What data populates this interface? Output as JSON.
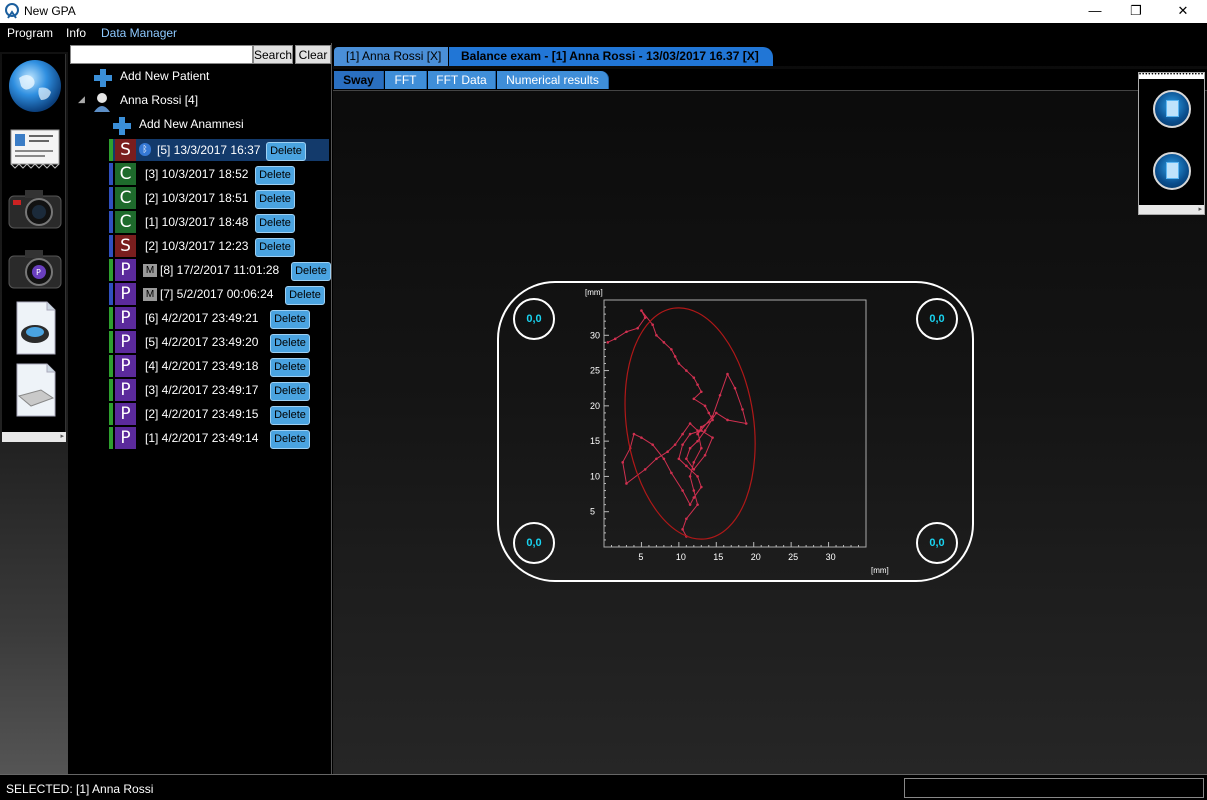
{
  "window": {
    "title": "New GPA",
    "minimize_glyph": "—",
    "maximize_glyph": "❐",
    "close_glyph": "✕"
  },
  "menu": {
    "program": "Program",
    "info": "Info",
    "data_manager": "Data Manager"
  },
  "toolbar": {
    "tools": [
      "globe-icon",
      "id-card-icon",
      "camera-icon",
      "camera-p-icon",
      "document-foot-icon",
      "document-platform-icon"
    ],
    "collapse_glyph": "▸"
  },
  "tree": {
    "search_placeholder": "",
    "search_label": "Search",
    "clear_label": "Clear",
    "add_patient_label": "Add New Patient",
    "patient_label": "Anna Rossi [4]",
    "add_anamnesis_label": "Add New Anamnesi",
    "delete_label": "Delete",
    "exams": [
      {
        "type": "S",
        "type_color": "#7a1e1e",
        "bar_color": "#2ea02e",
        "label": "[5] 13/3/2017 16:37",
        "bluetooth": true,
        "manual": false,
        "selected": true
      },
      {
        "type": "C",
        "type_color": "#1e6b2c",
        "bar_color": "#3050c0",
        "label": "[3] 10/3/2017 18:52",
        "bluetooth": false,
        "manual": false,
        "selected": false
      },
      {
        "type": "C",
        "type_color": "#1e6b2c",
        "bar_color": "#3050c0",
        "label": "[2] 10/3/2017 18:51",
        "bluetooth": false,
        "manual": false,
        "selected": false
      },
      {
        "type": "C",
        "type_color": "#1e6b2c",
        "bar_color": "#3050c0",
        "label": "[1] 10/3/2017 18:48",
        "bluetooth": false,
        "manual": false,
        "selected": false
      },
      {
        "type": "S",
        "type_color": "#7a1e1e",
        "bar_color": "#3050c0",
        "label": "[2] 10/3/2017 12:23",
        "bluetooth": false,
        "manual": false,
        "selected": false
      },
      {
        "type": "P",
        "type_color": "#5b2a9c",
        "bar_color": "#2ea02e",
        "label": "[8] 17/2/2017 11:01:28",
        "bluetooth": false,
        "manual": true,
        "selected": false
      },
      {
        "type": "P",
        "type_color": "#5b2a9c",
        "bar_color": "#3050c0",
        "label": "[7] 5/2/2017 00:06:24",
        "bluetooth": false,
        "manual": true,
        "selected": false
      },
      {
        "type": "P",
        "type_color": "#5b2a9c",
        "bar_color": "#2ea02e",
        "label": "[6] 4/2/2017 23:49:21",
        "bluetooth": false,
        "manual": false,
        "selected": false
      },
      {
        "type": "P",
        "type_color": "#5b2a9c",
        "bar_color": "#2ea02e",
        "label": "[5] 4/2/2017 23:49:20",
        "bluetooth": false,
        "manual": false,
        "selected": false
      },
      {
        "type": "P",
        "type_color": "#5b2a9c",
        "bar_color": "#2ea02e",
        "label": "[4] 4/2/2017 23:49:18",
        "bluetooth": false,
        "manual": false,
        "selected": false
      },
      {
        "type": "P",
        "type_color": "#5b2a9c",
        "bar_color": "#2ea02e",
        "label": "[3] 4/2/2017 23:49:17",
        "bluetooth": false,
        "manual": false,
        "selected": false
      },
      {
        "type": "P",
        "type_color": "#5b2a9c",
        "bar_color": "#2ea02e",
        "label": "[2] 4/2/2017 23:49:15",
        "bluetooth": false,
        "manual": false,
        "selected": false
      },
      {
        "type": "P",
        "type_color": "#5b2a9c",
        "bar_color": "#2ea02e",
        "label": "[1] 4/2/2017 23:49:14",
        "bluetooth": false,
        "manual": false,
        "selected": false
      }
    ],
    "manual_badge": "M",
    "bluetooth_glyph": "ᛒ"
  },
  "tabs": {
    "doc_tab_1": "[1] Anna Rossi [X]",
    "doc_tab_2": "Balance exam - [1] Anna Rossi - 13/03/2017 16.37 [X]",
    "sway": "Sway",
    "fft": "FFT",
    "fft_data": "FFT Data",
    "numerical": "Numerical results"
  },
  "side_panel": {
    "buttons": [
      "pdf-export-icon",
      "xls-export-icon"
    ],
    "collapse_glyph": "▸"
  },
  "plot": {
    "corner_values": [
      "0,0",
      "0,0",
      "0,0",
      "0,0"
    ],
    "x_unit": "[mm]",
    "y_unit": "[mm]",
    "x_ticks": [
      "5",
      "10",
      "15",
      "20",
      "25",
      "30"
    ],
    "y_ticks": [
      "5",
      "10",
      "15",
      "20",
      "25",
      "30"
    ],
    "trace_color": "#d03050",
    "ellipse_color": "#b01818"
  },
  "chart_data": {
    "type": "scatter",
    "xlabel": "[mm]",
    "ylabel": "[mm]",
    "xlim": [
      0,
      35
    ],
    "ylim": [
      0,
      35
    ],
    "grid": false,
    "series": [
      {
        "x": [
          0.5,
          1.5,
          3.0,
          4.5,
          5.5,
          5.0,
          6.5,
          7.0,
          8.0,
          9.0,
          9.5,
          10.0,
          11.0,
          12.0,
          12.5,
          13.0,
          12.0,
          13.5,
          14.0,
          14.5,
          13.0,
          12.5,
          14.5,
          15.5,
          16.5,
          17.5,
          18.5,
          19.0,
          16.5,
          15.0,
          13.5,
          12.5,
          11.5,
          11.0,
          12.0,
          13.5,
          14.5,
          13.0,
          11.5,
          10.5,
          10.0,
          11.0,
          12.5,
          13.0,
          12.0,
          11.5,
          10.5,
          9.0,
          8.0,
          6.5,
          5.0,
          4.0,
          3.5,
          2.5,
          3.0,
          5.5,
          7.0,
          8.5,
          9.5,
          10.5,
          11.5,
          12.5,
          13.0,
          12.0,
          11.5,
          12.0,
          12.5,
          11.0,
          10.5,
          11.0
        ],
        "y": [
          29.0,
          29.5,
          30.5,
          31.0,
          32.5,
          33.5,
          31.5,
          30.0,
          29.0,
          28.0,
          27.0,
          26.0,
          25.0,
          24.0,
          23.0,
          22.0,
          21.0,
          20.0,
          19.0,
          18.0,
          17.0,
          16.0,
          18.5,
          21.5,
          24.5,
          22.5,
          19.5,
          17.5,
          18.0,
          19.0,
          16.5,
          15.0,
          14.0,
          12.5,
          11.0,
          13.0,
          15.5,
          16.5,
          16.0,
          14.5,
          12.5,
          11.5,
          10.0,
          8.5,
          7.0,
          6.0,
          8.0,
          10.5,
          12.5,
          14.5,
          15.5,
          16.0,
          14.0,
          12.0,
          9.0,
          11.0,
          12.5,
          13.5,
          14.5,
          16.0,
          17.5,
          16.5,
          14.0,
          12.0,
          10.0,
          8.0,
          6.0,
          4.0,
          2.5,
          1.5
        ]
      }
    ],
    "ellipse": {
      "cx": 11.5,
      "cy": 17.5,
      "rx": 8.5,
      "ry": 16.5
    }
  },
  "status": {
    "text": "SELECTED: [1] Anna Rossi"
  }
}
